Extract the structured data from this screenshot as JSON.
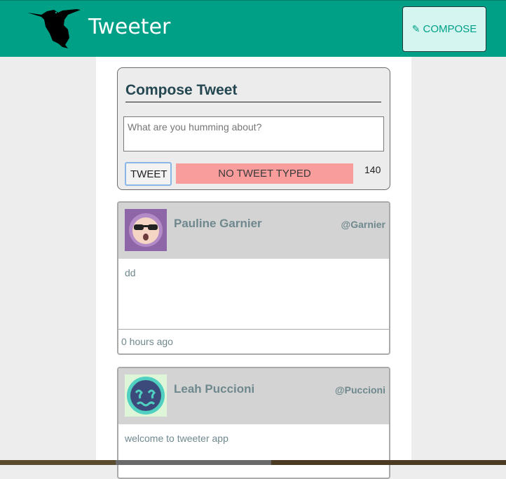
{
  "nav": {
    "brand": "Tweeter",
    "compose_label": "COMPOSE",
    "compose_icon": "pencil-icon",
    "logo_icon": "hummingbird-icon",
    "bg_color": "#00a087"
  },
  "compose": {
    "title": "Compose Tweet",
    "placeholder": "What are you humming about?",
    "value": "",
    "tweet_button": "TWEET",
    "error_message": "NO TWEET TYPED",
    "counter": "140"
  },
  "tweets": [
    {
      "name": "Pauline Garnier",
      "handle": "@Garnier",
      "text": "dd",
      "time": "0 hours ago",
      "avatar_icon": "sunglasses-face-avatar"
    },
    {
      "name": "Leah Puccioni",
      "handle": "@Puccioni",
      "text": "welcome to tweeter app",
      "time": "",
      "avatar_icon": "dizzy-face-avatar"
    }
  ]
}
